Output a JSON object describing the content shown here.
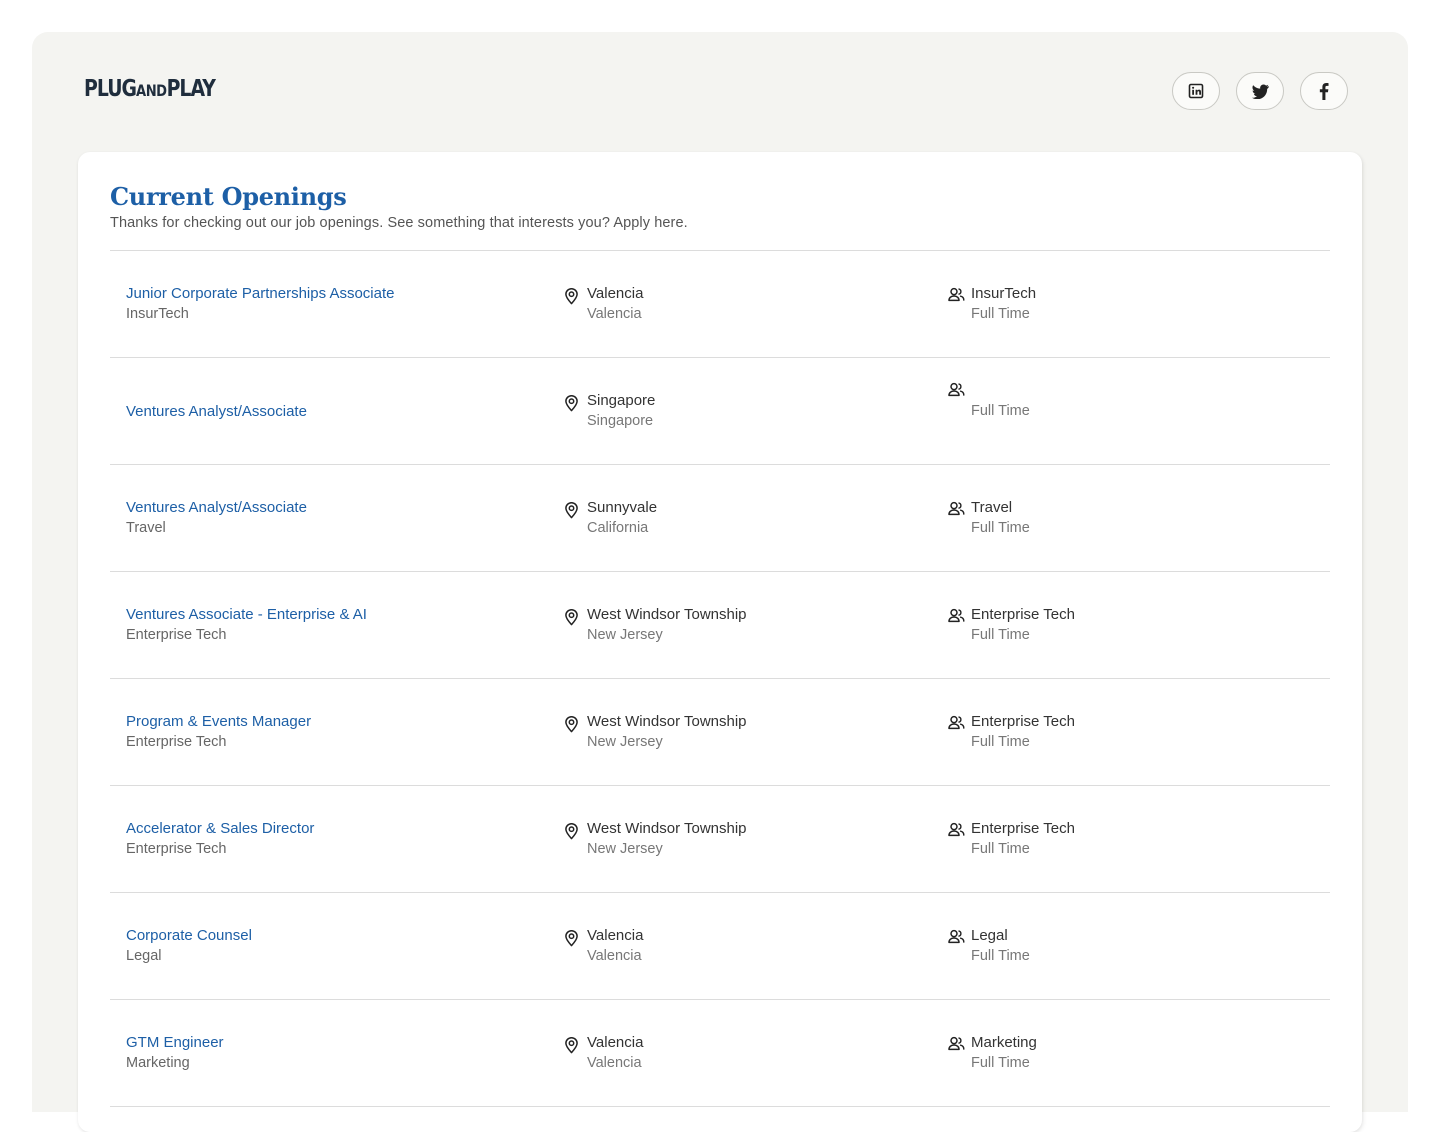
{
  "header": {
    "logo": {
      "part1": "PLUG",
      "part2": "AND",
      "part3": "PLAY"
    },
    "social_icons": [
      "linkedin-icon",
      "twitter-icon",
      "facebook-icon"
    ]
  },
  "openings": {
    "title": "Current Openings",
    "subtitle": "Thanks for checking out our job openings. See something that interests you? Apply here.",
    "jobs": [
      {
        "title": "Junior Corporate Partnerships Associate",
        "department": "InsurTech",
        "city": "Valencia",
        "region": "Valencia",
        "team": "InsurTech",
        "type": "Full Time"
      },
      {
        "title": "Ventures Analyst/Associate",
        "department": "",
        "city": "Singapore",
        "region": "Singapore",
        "team": "",
        "type": "Full Time"
      },
      {
        "title": "Ventures Analyst/Associate",
        "department": "Travel",
        "city": "Sunnyvale",
        "region": "California",
        "team": "Travel",
        "type": "Full Time"
      },
      {
        "title": "Ventures Associate - Enterprise & AI",
        "department": "Enterprise Tech",
        "city": "West Windsor Township",
        "region": "New Jersey",
        "team": "Enterprise Tech",
        "type": "Full Time"
      },
      {
        "title": "Program & Events Manager",
        "department": "Enterprise Tech",
        "city": "West Windsor Township",
        "region": "New Jersey",
        "team": "Enterprise Tech",
        "type": "Full Time"
      },
      {
        "title": "Accelerator & Sales Director",
        "department": "Enterprise Tech",
        "city": "West Windsor Township",
        "region": "New Jersey",
        "team": "Enterprise Tech",
        "type": "Full Time"
      },
      {
        "title": "Corporate Counsel",
        "department": "Legal",
        "city": "Valencia",
        "region": "Valencia",
        "team": "Legal",
        "type": "Full Time"
      },
      {
        "title": "GTM Engineer",
        "department": "Marketing",
        "city": "Valencia",
        "region": "Valencia",
        "team": "Marketing",
        "type": "Full Time"
      }
    ]
  },
  "icons": {
    "location": "map-pin-icon",
    "team": "users-icon"
  },
  "colors": {
    "accent": "#1d5fa6",
    "page_bg": "#f4f4f1",
    "text": "#333333",
    "muted": "#777777",
    "divider": "#dcdcdc"
  }
}
